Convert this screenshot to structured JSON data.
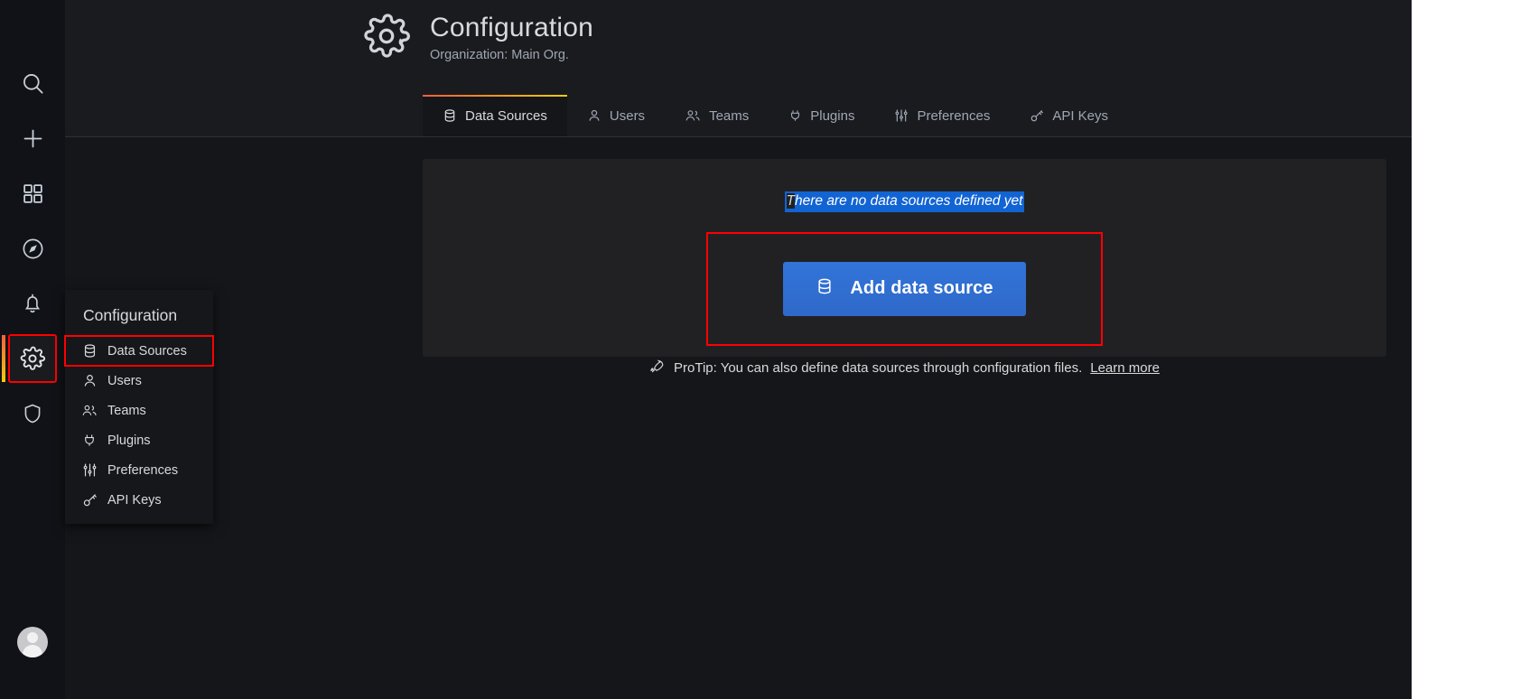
{
  "app": {
    "title": "Grafana Configuration"
  },
  "colors": {
    "accent_gradient_start": "#f55f3e",
    "accent_gradient_end": "#f2cc0c",
    "primary_button": "#3274d9",
    "selection_highlight": "#1264d3",
    "annotation_box": "#ff0000",
    "panel_bg": "#212124",
    "page_bg": "#141619",
    "nav_bg": "#111217"
  },
  "navrail": {
    "items": [
      {
        "name": "search-icon",
        "label": "Search",
        "active": false
      },
      {
        "name": "plus-icon",
        "label": "Create",
        "active": false
      },
      {
        "name": "dashboards-icon",
        "label": "Dashboards",
        "active": false
      },
      {
        "name": "compass-icon",
        "label": "Explore",
        "active": false
      },
      {
        "name": "bell-icon",
        "label": "Alerting",
        "active": false
      },
      {
        "name": "gear-icon",
        "label": "Configuration",
        "active": true
      },
      {
        "name": "shield-icon",
        "label": "Server Admin",
        "active": false
      }
    ],
    "avatar_label": "User profile"
  },
  "flyout": {
    "title": "Configuration",
    "items": [
      {
        "label": "Data Sources",
        "icon": "database-icon",
        "highlighted": true
      },
      {
        "label": "Users",
        "icon": "user-icon",
        "highlighted": false
      },
      {
        "label": "Teams",
        "icon": "users-icon",
        "highlighted": false
      },
      {
        "label": "Plugins",
        "icon": "plug-icon",
        "highlighted": false
      },
      {
        "label": "Preferences",
        "icon": "sliders-icon",
        "highlighted": false
      },
      {
        "label": "API Keys",
        "icon": "key-icon",
        "highlighted": false
      }
    ]
  },
  "header": {
    "icon": "gear-icon",
    "title": "Configuration",
    "subtitle": "Organization: Main Org."
  },
  "tabs": [
    {
      "label": "Data Sources",
      "icon": "database-icon",
      "active": true
    },
    {
      "label": "Users",
      "icon": "user-icon",
      "active": false
    },
    {
      "label": "Teams",
      "icon": "users-icon",
      "active": false
    },
    {
      "label": "Plugins",
      "icon": "plug-icon",
      "active": false
    },
    {
      "label": "Preferences",
      "icon": "sliders-icon",
      "active": false
    },
    {
      "label": "API Keys",
      "icon": "key-icon",
      "active": false
    }
  ],
  "main": {
    "empty_message_lead": "T",
    "empty_message_selected": "here are no data sources defined yet",
    "add_button_label": "Add data source",
    "add_button_icon": "database-icon",
    "protip_icon": "rocket-icon",
    "protip_text": "ProTip: You can also define data sources through configuration files.",
    "protip_link": "Learn more"
  }
}
